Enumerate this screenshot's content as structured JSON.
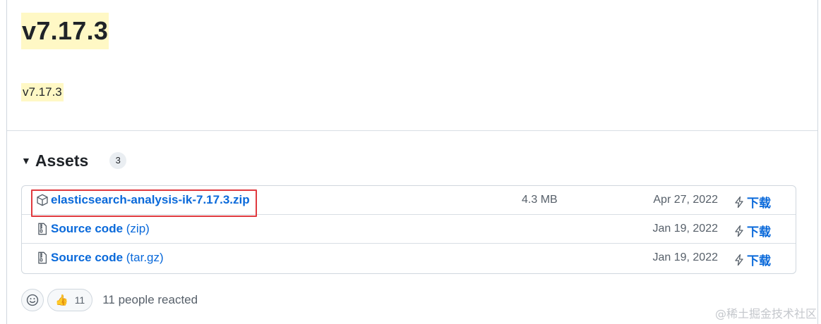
{
  "release": {
    "title": "v7.17.3",
    "subtitle": "v7.17.3"
  },
  "assets": {
    "heading": "Assets",
    "count": "3",
    "rows": [
      {
        "name": "elasticsearch-analysis-ik-7.17.3.zip",
        "suffix": "",
        "size": "4.3 MB",
        "date": "Apr 27, 2022",
        "download": "下载",
        "icon": "package-icon"
      },
      {
        "name": "Source code",
        "suffix": " (zip)",
        "size": "",
        "date": "Jan 19, 2022",
        "download": "下载",
        "icon": "file-zip-icon"
      },
      {
        "name": "Source code",
        "suffix": " (tar.gz)",
        "size": "",
        "date": "Jan 19, 2022",
        "download": "下载",
        "icon": "file-zip-icon"
      }
    ]
  },
  "reactions": {
    "thumbs_emoji": "👍",
    "thumbs_count": "11",
    "summary": "11 people reacted"
  },
  "watermark": "@稀土掘金技术社区",
  "colors": {
    "link": "#0969da",
    "highlight": "#fff8c5",
    "annotation_box": "#e0393e"
  }
}
